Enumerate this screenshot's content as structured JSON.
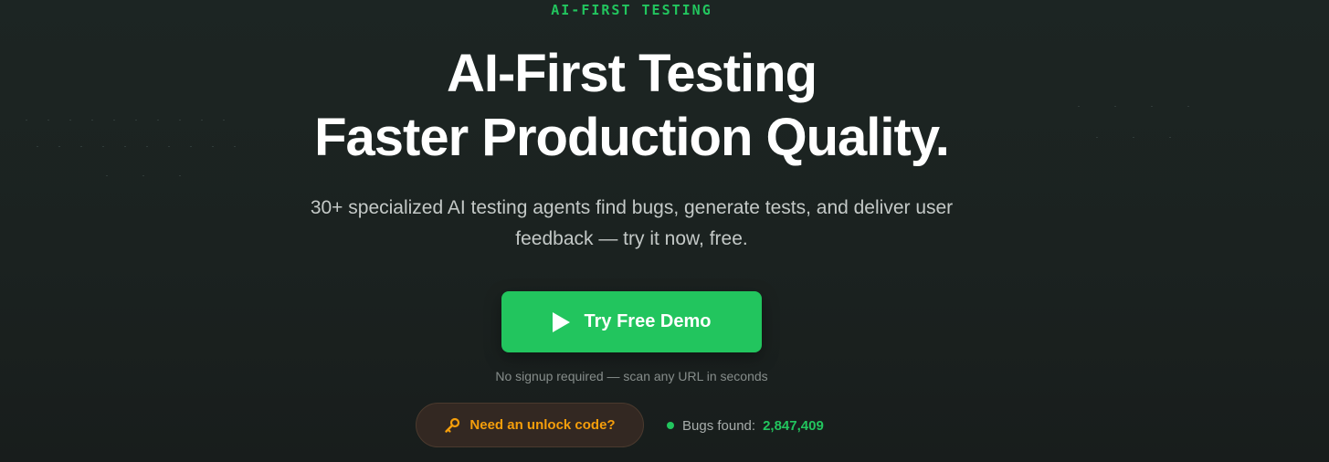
{
  "hero": {
    "eyebrow": "AI-FIRST TESTING",
    "headline_line1": "AI-First Testing",
    "headline_line2": "Faster Production Quality.",
    "subtitle_line1": "30+ specialized AI testing agents find bugs, generate tests, and deliver user",
    "subtitle_line2": "feedback — try it now, free.",
    "cta": {
      "label": "Try Free Demo",
      "icon": "play-icon"
    },
    "note": "No signup required — scan any URL in seconds",
    "unlock": {
      "label": "Need an unlock code?",
      "icon": "key-icon"
    },
    "stats": {
      "label": "Bugs found:",
      "value": "2,847,409",
      "icon": "status-dot-icon"
    }
  },
  "colors": {
    "accent_green": "#22c55e",
    "accent_orange": "#f59e0b",
    "background": "#1b2220"
  }
}
